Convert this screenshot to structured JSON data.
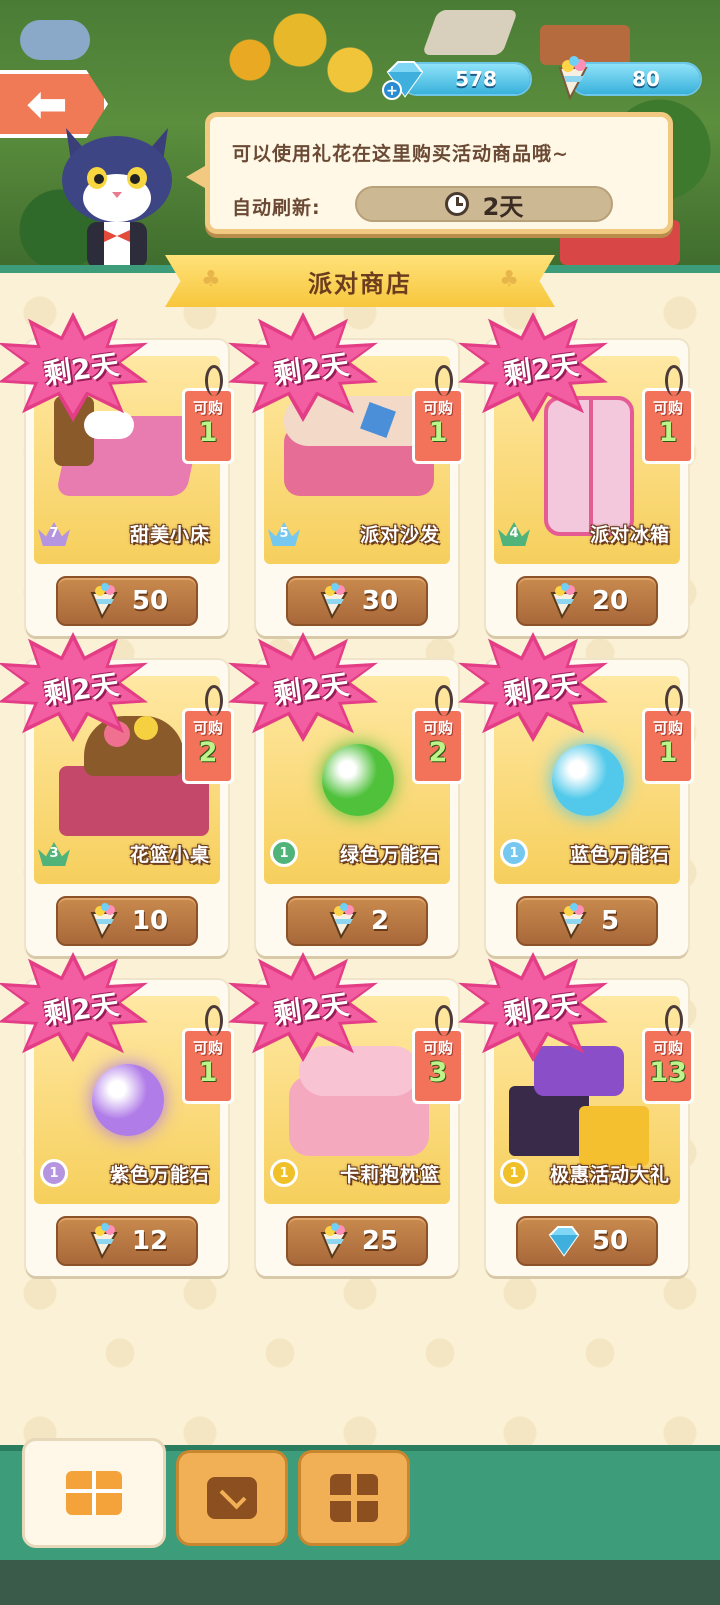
{
  "header": {
    "back_label": "",
    "gems": "578",
    "flowers": "80"
  },
  "bubble": {
    "message": "可以使用礼花在这里购买活动商品哦~",
    "refresh_label": "自动刷新:",
    "refresh_time": "2天"
  },
  "shop": {
    "title": "派对商店",
    "items": [
      {
        "name": "甜美小床",
        "badge": "剩2天",
        "limit_label": "可购",
        "limit": "1",
        "level": "7",
        "price": "50",
        "currency": "flower-icon",
        "art_color": "#e87bb0"
      },
      {
        "name": "派对沙发",
        "badge": "剩2天",
        "limit_label": "可购",
        "limit": "1",
        "level": "5",
        "price": "30",
        "currency": "flower-icon",
        "art_color": "#f3d9c8"
      },
      {
        "name": "派对冰箱",
        "badge": "剩2天",
        "limit_label": "可购",
        "limit": "1",
        "level": "4",
        "price": "20",
        "currency": "flower-icon",
        "art_color": "#f4c8dc"
      },
      {
        "name": "花篮小桌",
        "badge": "剩2天",
        "limit_label": "可购",
        "limit": "2",
        "level": "3",
        "price": "10",
        "currency": "flower-icon",
        "art_color": "#c4486a"
      },
      {
        "name": "绿色万能石",
        "badge": "剩2天",
        "limit_label": "可购",
        "limit": "2",
        "level": "1",
        "price": "2",
        "currency": "flower-icon",
        "art_color": "#4fc13b"
      },
      {
        "name": "蓝色万能石",
        "badge": "剩2天",
        "limit_label": "可购",
        "limit": "1",
        "level": "1",
        "price": "5",
        "currency": "flower-icon",
        "art_color": "#52c9ea"
      },
      {
        "name": "紫色万能石",
        "badge": "剩2天",
        "limit_label": "可购",
        "limit": "1",
        "level": "1",
        "price": "12",
        "currency": "flower-icon",
        "art_color": "#b07ce8"
      },
      {
        "name": "卡莉抱枕篮",
        "badge": "剩2天",
        "limit_label": "可购",
        "limit": "3",
        "level": "1",
        "price": "25",
        "currency": "flower-icon",
        "art_color": "#f5a9bf"
      },
      {
        "name": "极惠活动大礼",
        "badge": "剩2天",
        "limit_label": "可购",
        "limit": "13",
        "level": "1",
        "price": "50",
        "currency": "gem-icon",
        "art_color": "#8a4fc8"
      }
    ]
  },
  "tabs": [
    {
      "name": "gift-tab",
      "icon": "gift-icon",
      "active": true
    },
    {
      "name": "bag-tab",
      "icon": "bag-icon",
      "active": false
    },
    {
      "name": "grid-tab",
      "icon": "grid-icon",
      "active": false
    }
  ],
  "colors": {
    "accent_green": "#3d9c7a",
    "badge_pink": "#e23d85",
    "tag_red": "#f2725a",
    "price_brown": "#a8683a"
  }
}
